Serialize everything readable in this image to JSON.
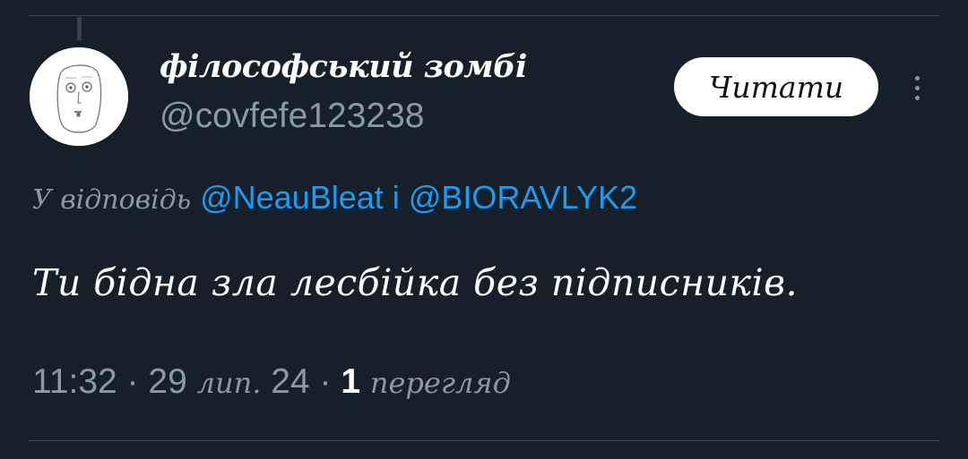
{
  "tweet": {
    "author": {
      "display_name": "філософський зомбі",
      "handle": "@covfefe123238"
    },
    "follow_label": "Читати",
    "more_icon": "more-vertical-icon",
    "reply_to": {
      "prefix": "У відповідь",
      "mentions": [
        "@NeauBleat",
        "@BIORAVLYK2"
      ],
      "separator": "і"
    },
    "text": "Ти бідна зла лесбійка без підписників.",
    "meta": {
      "time": "11:32",
      "dot": "·",
      "day": "29",
      "month": "лип.",
      "year": "24",
      "views_count": "1",
      "views_label": "перегляд"
    }
  },
  "colors": {
    "background": "#15202b",
    "text": "#ffffff",
    "secondary": "#8b98a5",
    "accent": "#1d9bf0",
    "divider": "#38444d"
  }
}
